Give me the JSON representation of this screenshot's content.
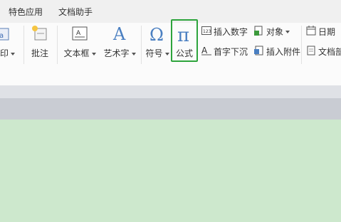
{
  "menu": {
    "items": [
      "特色应用",
      "文档助手"
    ]
  },
  "ribbon": {
    "print_label": "印",
    "comment_label": "批注",
    "textbox_label": "文本框",
    "wordart_label": "艺术字",
    "symbol_label": "符号",
    "formula_label": "公式",
    "insert_number_label": "插入数字",
    "object_label": "对象",
    "date_label": "日期",
    "dropcap_label": "首字下沉",
    "attachment_label": "插入附件",
    "doc_label": "文档部"
  },
  "colors": {
    "highlight": "#2da43c",
    "accent": "#4a7fc1",
    "document_bg": "#cde8cd"
  }
}
